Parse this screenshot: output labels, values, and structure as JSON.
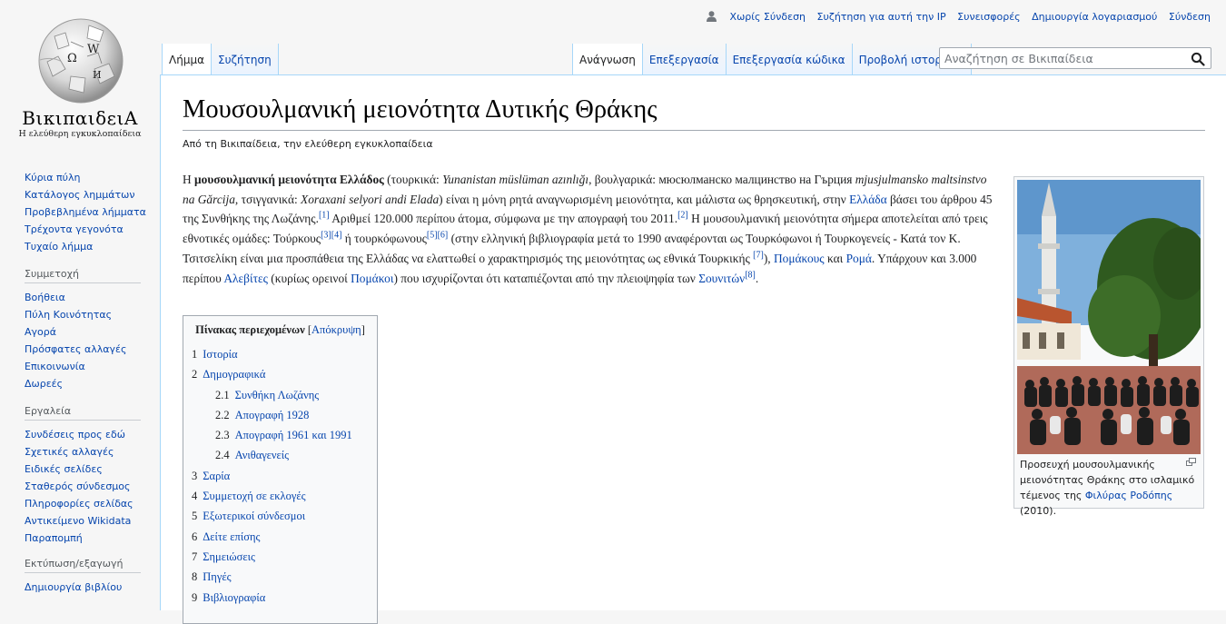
{
  "logo": {
    "wordmark": "ΒικιπαιδειΑ",
    "tagline": "Η ελεύθερη εγκυκλοπαίδεια",
    "globe_glyphs": [
      "Ω",
      "W",
      "И"
    ]
  },
  "personal": {
    "anon": "Χωρίς Σύνδεση",
    "items": [
      "Συζήτηση για αυτή την IP",
      "Συνεισφορές",
      "Δημιουργία λογαριασμού",
      "Σύνδεση"
    ]
  },
  "tabs": {
    "left": [
      "Λήμμα",
      "Συζήτηση"
    ],
    "right": [
      "Ανάγνωση",
      "Επεξεργασία",
      "Επεξεργασία κώδικα",
      "Προβολή ιστορικού"
    ]
  },
  "search": {
    "placeholder": "Αναζήτηση σε Βικιπαίδεια"
  },
  "sidebar": {
    "navigation": [
      "Κύρια πύλη",
      "Κατάλογος λημμάτων",
      "Προβεβλημένα λήμματα",
      "Τρέχοντα γεγονότα",
      "Τυχαίο λήμμα"
    ],
    "participation": {
      "heading": "Συμμετοχή",
      "items": [
        "Βοήθεια",
        "Πύλη Κοινότητας",
        "Αγορά",
        "Πρόσφατες αλλαγές",
        "Επικοινωνία",
        "Δωρεές"
      ]
    },
    "tools": {
      "heading": "Εργαλεία",
      "items": [
        "Συνδέσεις προς εδώ",
        "Σχετικές αλλαγές",
        "Ειδικές σελίδες",
        "Σταθερός σύνδεσμος",
        "Πληροφορίες σελίδας",
        "Αντικείμενο Wikidata",
        "Παραπομπή"
      ]
    },
    "print": {
      "heading": "Εκτύπωση/εξαγωγή",
      "items": [
        "Δημιουργία βιβλίου"
      ]
    }
  },
  "article": {
    "title": "Μουσουλμανική μειονότητα Δυτικής Θράκης",
    "site_sub": "Από τη Βικιπαίδεια, την ελεύθερη εγκυκλοπαίδεια",
    "intro": {
      "t1": "Η ",
      "bold": "μουσουλμανική μειονότητα Ελλάδος",
      "t2": " (τουρκικά: ",
      "i1": "Yunanistan müslüman azınlığı",
      "t3": ", βουλγαρικά: мюсюлманско малцинство на Гърция ",
      "i2": "mjusjulmansko maltsinstvo na Gărcija",
      "t4": ", τσιγγανικά: ",
      "i3": "Xoraxani selyori andi Elada",
      "t5": ") είναι η μόνη ρητά αναγνωρισμένη μειονότητα, και μάλιστα ως θρησκευτική, στην ",
      "l_greece": "Ελλάδα",
      "t6": " βάσει του άρθρου 45 της Συνθήκης της Λωζάνης.",
      "r1": "[1]",
      "t7": " Αριθμεί 120.000 περίπου άτομα, σύμφωνα με την απογραφή του 2011.",
      "r2": "[2]",
      "t8": " Η μουσουλμανική μειονότητα σήμερα αποτελείται από τρεις εθνοτικές ομάδες: Τούρκους",
      "r3": "[3]",
      "r4": "[4]",
      "t9": " ή τουρκόφωνους",
      "r5": "[5]",
      "r6": "[6]",
      "t10": " (στην ελληνική βιβλιογραφία μετά το 1990 αναφέρονται ως Τουρκόφωνοι ή Τουρκογενείς - Κατά τον Κ. Τσιτσελίκη είναι μια προσπάθεια της Ελλάδας να ελαττωθεί ο χαρακτηρισμός της μειονότητας ως εθνικά Τουρκικής ",
      "r7": "[7]",
      "t11": "), ",
      "l_pomaks": "Πομάκους",
      "t12": " και ",
      "l_roma": "Ρομά",
      "t13": ". Υπάρχουν και 3.000 περίπου ",
      "l_alevis": "Αλεβίτες",
      "t14": " (κυρίως ορεινοί ",
      "l_pomaks2": "Πομάκοι",
      "t15": ") που ισχυρίζονται ότι καταπιέζονται από την πλειοψηφία των ",
      "l_sunnis": "Σουνιτών",
      "r8": "[8]",
      "t16": "."
    }
  },
  "thumb": {
    "caption_pre": "Προσευχή μουσουλμανικής μειονότητας Θράκης στο ισλαμικό τέμενος της ",
    "caption_link": "Φιλύρας Ροδόπης",
    "caption_post": " (2010)."
  },
  "toc": {
    "title": "Πίνακας περιεχομένων",
    "hide_open": "[",
    "hide": "Απόκρυψη",
    "hide_close": "]",
    "items": [
      {
        "num": "1",
        "label": "Ιστορία",
        "level": 1
      },
      {
        "num": "2",
        "label": "Δημογραφικά",
        "level": 1
      },
      {
        "num": "2.1",
        "label": "Συνθήκη Λωζάνης",
        "level": 2
      },
      {
        "num": "2.2",
        "label": "Απογραφή 1928",
        "level": 2
      },
      {
        "num": "2.3",
        "label": "Απογραφή 1961 και 1991",
        "level": 2
      },
      {
        "num": "2.4",
        "label": "Ανιθαγενείς",
        "level": 2
      },
      {
        "num": "3",
        "label": "Σαρία",
        "level": 1
      },
      {
        "num": "4",
        "label": "Συμμετοχή σε εκλογές",
        "level": 1
      },
      {
        "num": "5",
        "label": "Εξωτερικοί σύνδεσμοι",
        "level": 1
      },
      {
        "num": "6",
        "label": "Δείτε επίσης",
        "level": 1
      },
      {
        "num": "7",
        "label": "Σημειώσεις",
        "level": 1
      },
      {
        "num": "8",
        "label": "Πηγές",
        "level": 1
      },
      {
        "num": "9",
        "label": "Βιβλιογραφία",
        "level": 1
      }
    ]
  },
  "colors": {
    "link": "#0645ad",
    "border": "#a7d7f9",
    "text": "#202122"
  }
}
